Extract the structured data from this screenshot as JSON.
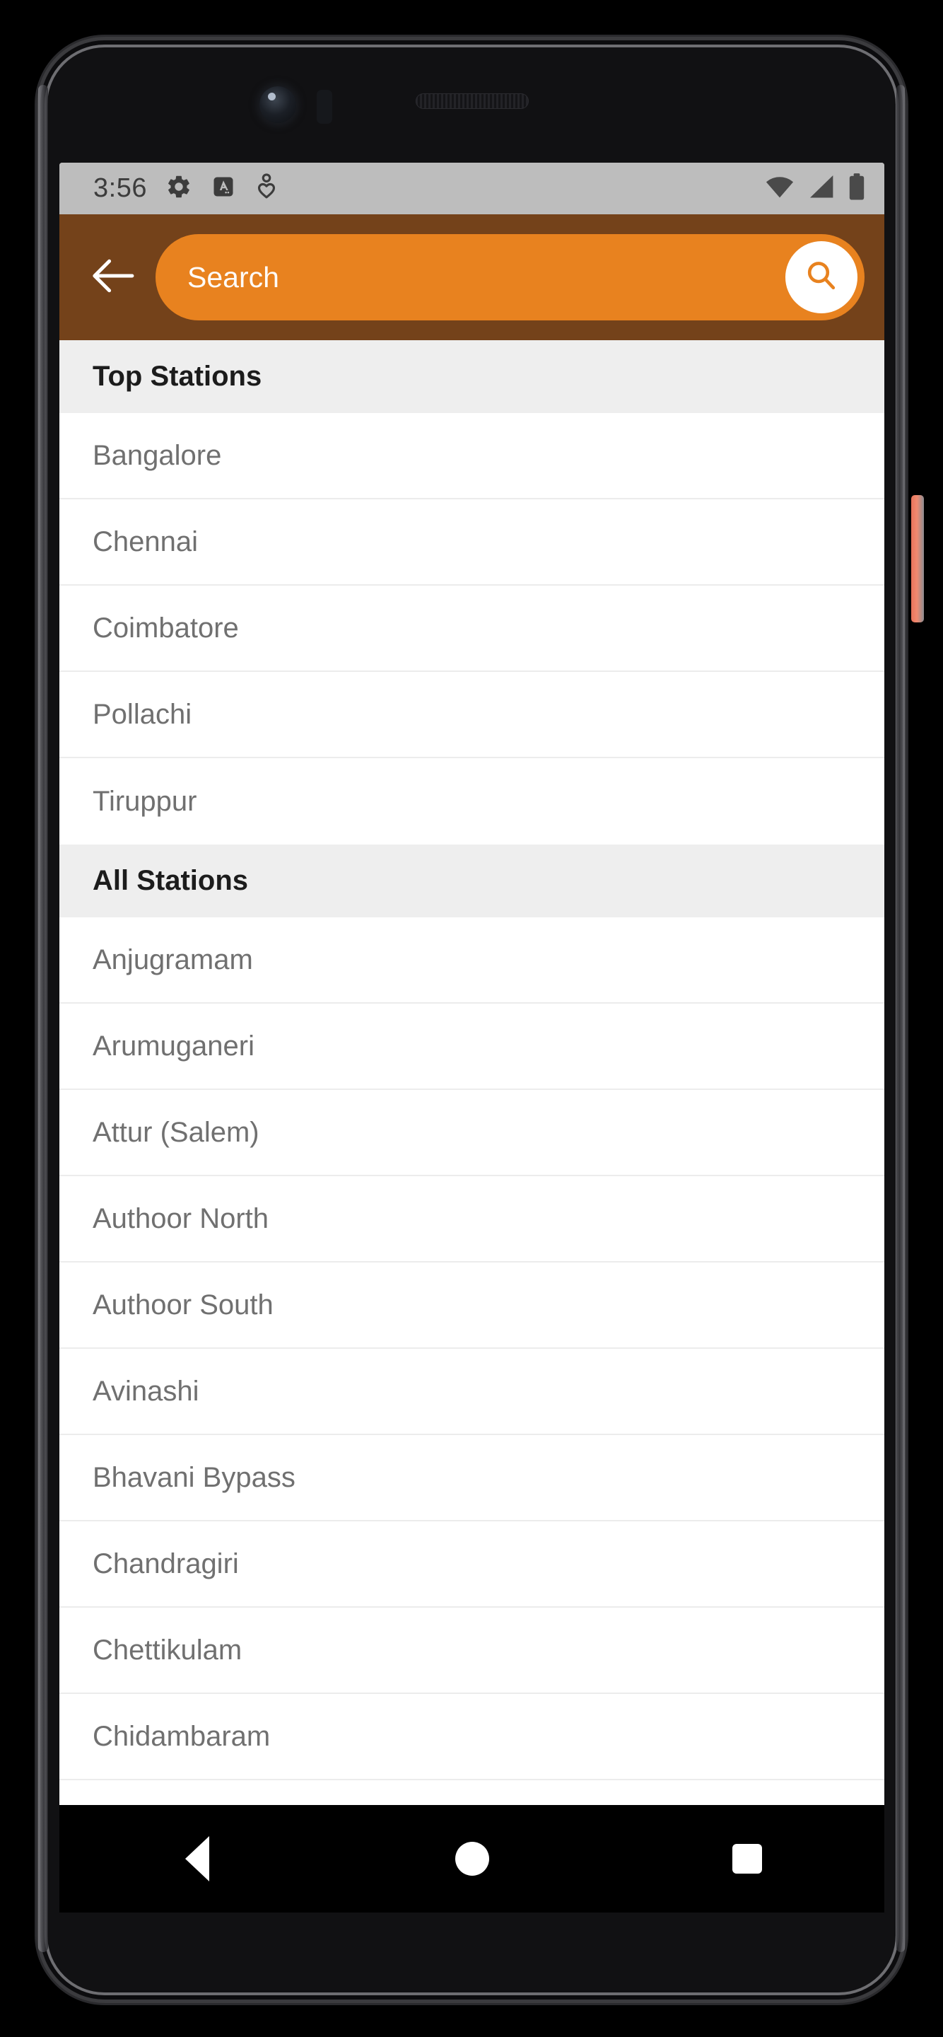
{
  "status_bar": {
    "time": "3:56",
    "left_icons": [
      "gear-icon",
      "a-badge-icon",
      "person-heart-icon"
    ],
    "right_icons": [
      "wifi-icon",
      "cellular-signal-icon",
      "battery-icon"
    ],
    "background_color": "#bdbdbd"
  },
  "app_bar": {
    "back_label": "back-arrow",
    "search_placeholder": "Search",
    "search_button_label": "search-icon",
    "bar_color": "#74421a",
    "field_color": "#e8821f"
  },
  "sections": [
    {
      "title": "Top Stations",
      "items": [
        "Bangalore",
        "Chennai",
        "Coimbatore",
        "Pollachi",
        "Tiruppur"
      ]
    },
    {
      "title": "All Stations",
      "items": [
        "Anjugramam",
        "Arumuganeri",
        "Attur (Salem)",
        "Authoor North",
        "Authoor South",
        "Avinashi",
        "Bhavani Bypass",
        "Chandragiri",
        "Chettikulam",
        "Chidambaram"
      ]
    }
  ],
  "nav_bar": {
    "back": "back-triangle",
    "home": "home-circle",
    "recents": "recents-square"
  }
}
